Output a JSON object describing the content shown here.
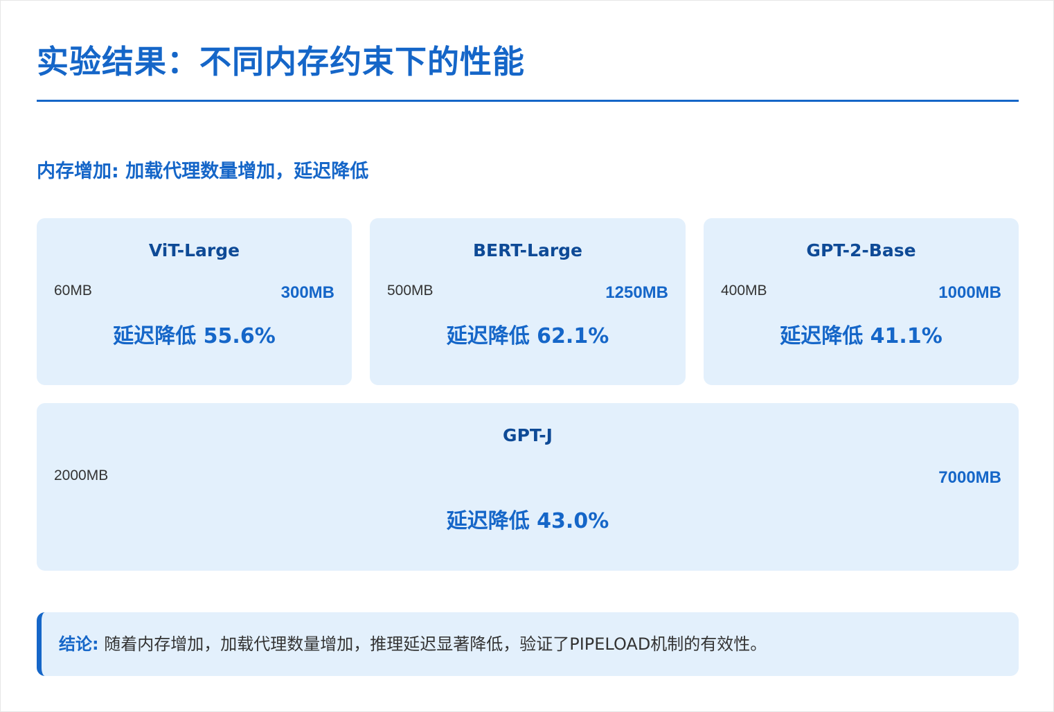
{
  "header": {
    "title": "实验结果：不同内存约束下的性能"
  },
  "section": {
    "subtitle": "内存增加: 加载代理数量增加，延迟降低"
  },
  "models": [
    {
      "name": "ViT-Large",
      "mem_low": "60MB",
      "mem_high": "300MB",
      "reduction": "延迟降低 55.6%"
    },
    {
      "name": "BERT-Large",
      "mem_low": "500MB",
      "mem_high": "1250MB",
      "reduction": "延迟降低 62.1%"
    },
    {
      "name": "GPT-2-Base",
      "mem_low": "400MB",
      "mem_high": "1000MB",
      "reduction": "延迟降低 41.1%"
    },
    {
      "name": "GPT-J",
      "mem_low": "2000MB",
      "mem_high": "7000MB",
      "reduction": "延迟降低 43.0%"
    }
  ],
  "conclusion": {
    "label": "结论:",
    "text": " 随着内存增加，加载代理数量增加，推理延迟显著降低，验证了PIPELOAD机制的有效性。"
  },
  "colors": {
    "accent": "#1566c8",
    "card_bg": "#e3f0fc",
    "card_title": "#0e4a96",
    "text": "#333333"
  }
}
